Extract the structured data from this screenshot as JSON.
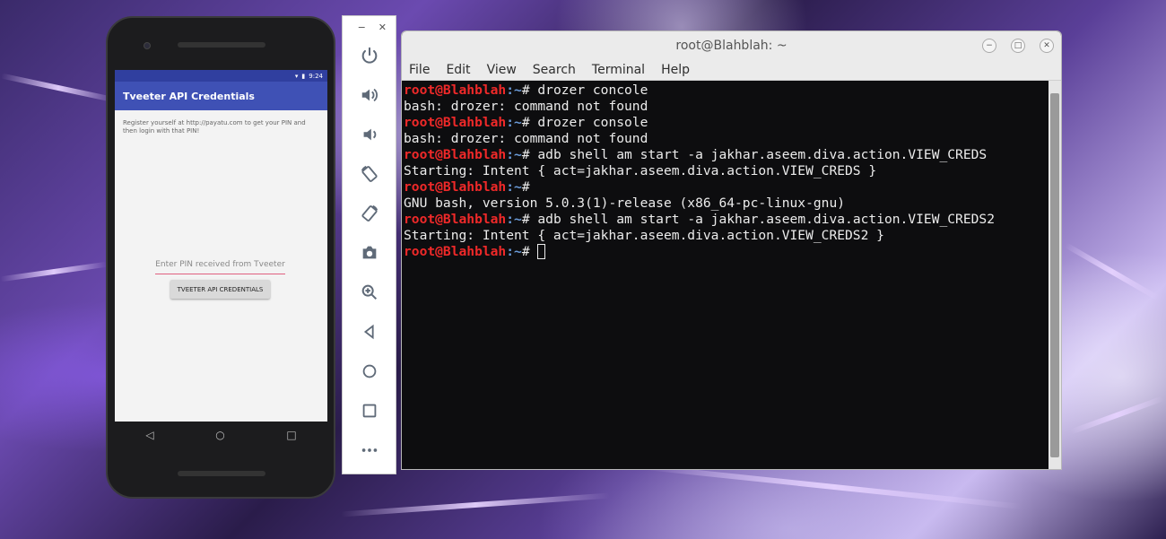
{
  "phone": {
    "status_time": "9:24",
    "app_title": "Tveeter API Credentials",
    "instructions": "Register yourself at http://payatu.com to get your PIN and then login with that PIN!",
    "pin_placeholder": "Enter PIN received from Tveeter",
    "button_label": "TVEETER API CREDENTIALS",
    "nav": {
      "back": "◁",
      "home": "○",
      "recents": "□"
    }
  },
  "emulator_toolbar": {
    "minimize": "−",
    "close": "✕",
    "buttons": [
      "power-icon",
      "volume-up-icon",
      "volume-down-icon",
      "rotate-left-icon",
      "rotate-right-icon",
      "camera-icon",
      "zoom-icon",
      "back-icon",
      "home-icon",
      "overview-icon",
      "more-icon"
    ]
  },
  "terminal": {
    "title": "root@Blahblah: ~",
    "menu": [
      "File",
      "Edit",
      "View",
      "Search",
      "Terminal",
      "Help"
    ],
    "prompt_user": "root@Blahblah",
    "prompt_path": ":~",
    "prompt_symbol": "# ",
    "lines": [
      {
        "type": "cmd",
        "text": "drozer concole"
      },
      {
        "type": "out",
        "text": "bash: drozer: command not found"
      },
      {
        "type": "cmd",
        "text": "drozer console"
      },
      {
        "type": "out",
        "text": "bash: drozer: command not found"
      },
      {
        "type": "cmd",
        "text": "adb shell am start -a jakhar.aseem.diva.action.VIEW_CREDS"
      },
      {
        "type": "out",
        "text": "Starting: Intent { act=jakhar.aseem.diva.action.VIEW_CREDS }"
      },
      {
        "type": "cmd",
        "text": ""
      },
      {
        "type": "out",
        "text": "GNU bash, version 5.0.3(1)-release (x86_64-pc-linux-gnu)"
      },
      {
        "type": "cmd",
        "text": "adb shell am start -a jakhar.aseem.diva.action.VIEW_CREDS2"
      },
      {
        "type": "out",
        "text": "Starting: Intent { act=jakhar.aseem.diva.action.VIEW_CREDS2 }"
      },
      {
        "type": "cmd",
        "text": "",
        "cursor": true
      }
    ]
  },
  "colors": {
    "prompt_user": "#ef2929",
    "prompt_path": "#6a9ad8",
    "app_bar": "#3f51b5",
    "status_bar": "#303f9f"
  }
}
